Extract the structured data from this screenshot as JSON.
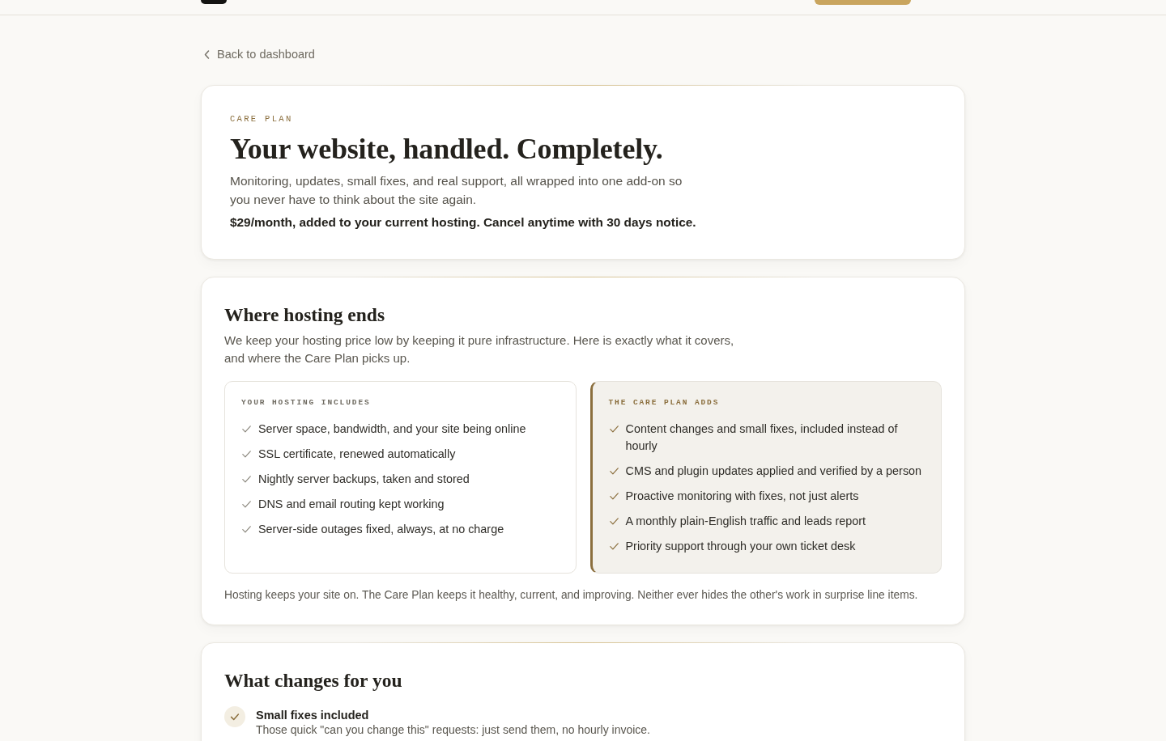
{
  "back_link": {
    "label": "Back to dashboard"
  },
  "intro": {
    "eyebrow": "CARE PLAN",
    "title": "Your website, handled. Completely.",
    "description": "Monitoring, updates, small fixes, and real support, all wrapped into one add-on so you never have to think about the site again.",
    "price_note": "$29/month, added to your current hosting. Cancel anytime with 30 days notice."
  },
  "hosting_section": {
    "title": "Where hosting ends",
    "description": "We keep your hosting price low by keeping it pure infrastructure. Here is exactly what it covers, and where the Care Plan picks up.",
    "columns": [
      {
        "kind": "included",
        "heading": "YOUR HOSTING INCLUDES",
        "items": [
          "Server space, bandwidth, and your site being online",
          "SSL certificate, renewed automatically",
          "Nightly server backups, taken and stored",
          "DNS and email routing kept working",
          "Server-side outages fixed, always, at no charge"
        ]
      },
      {
        "kind": "added",
        "heading": "THE CARE PLAN ADDS",
        "items": [
          "Content changes and small fixes, included instead of hourly",
          "CMS and plugin updates applied and verified by a person",
          "Proactive monitoring with fixes, not just alerts",
          "A monthly plain-English traffic and leads report",
          "Priority support through your own ticket desk"
        ]
      }
    ],
    "note": "Hosting keeps your site on. The Care Plan keeps it healthy, current, and improving. Neither ever hides the other's work in surprise line items."
  },
  "changes_section": {
    "title": "What changes for you",
    "items": [
      {
        "title": "Small fixes included",
        "description": "Those quick \"can you change this\" requests: just send them, no hourly invoice."
      }
    ]
  }
}
